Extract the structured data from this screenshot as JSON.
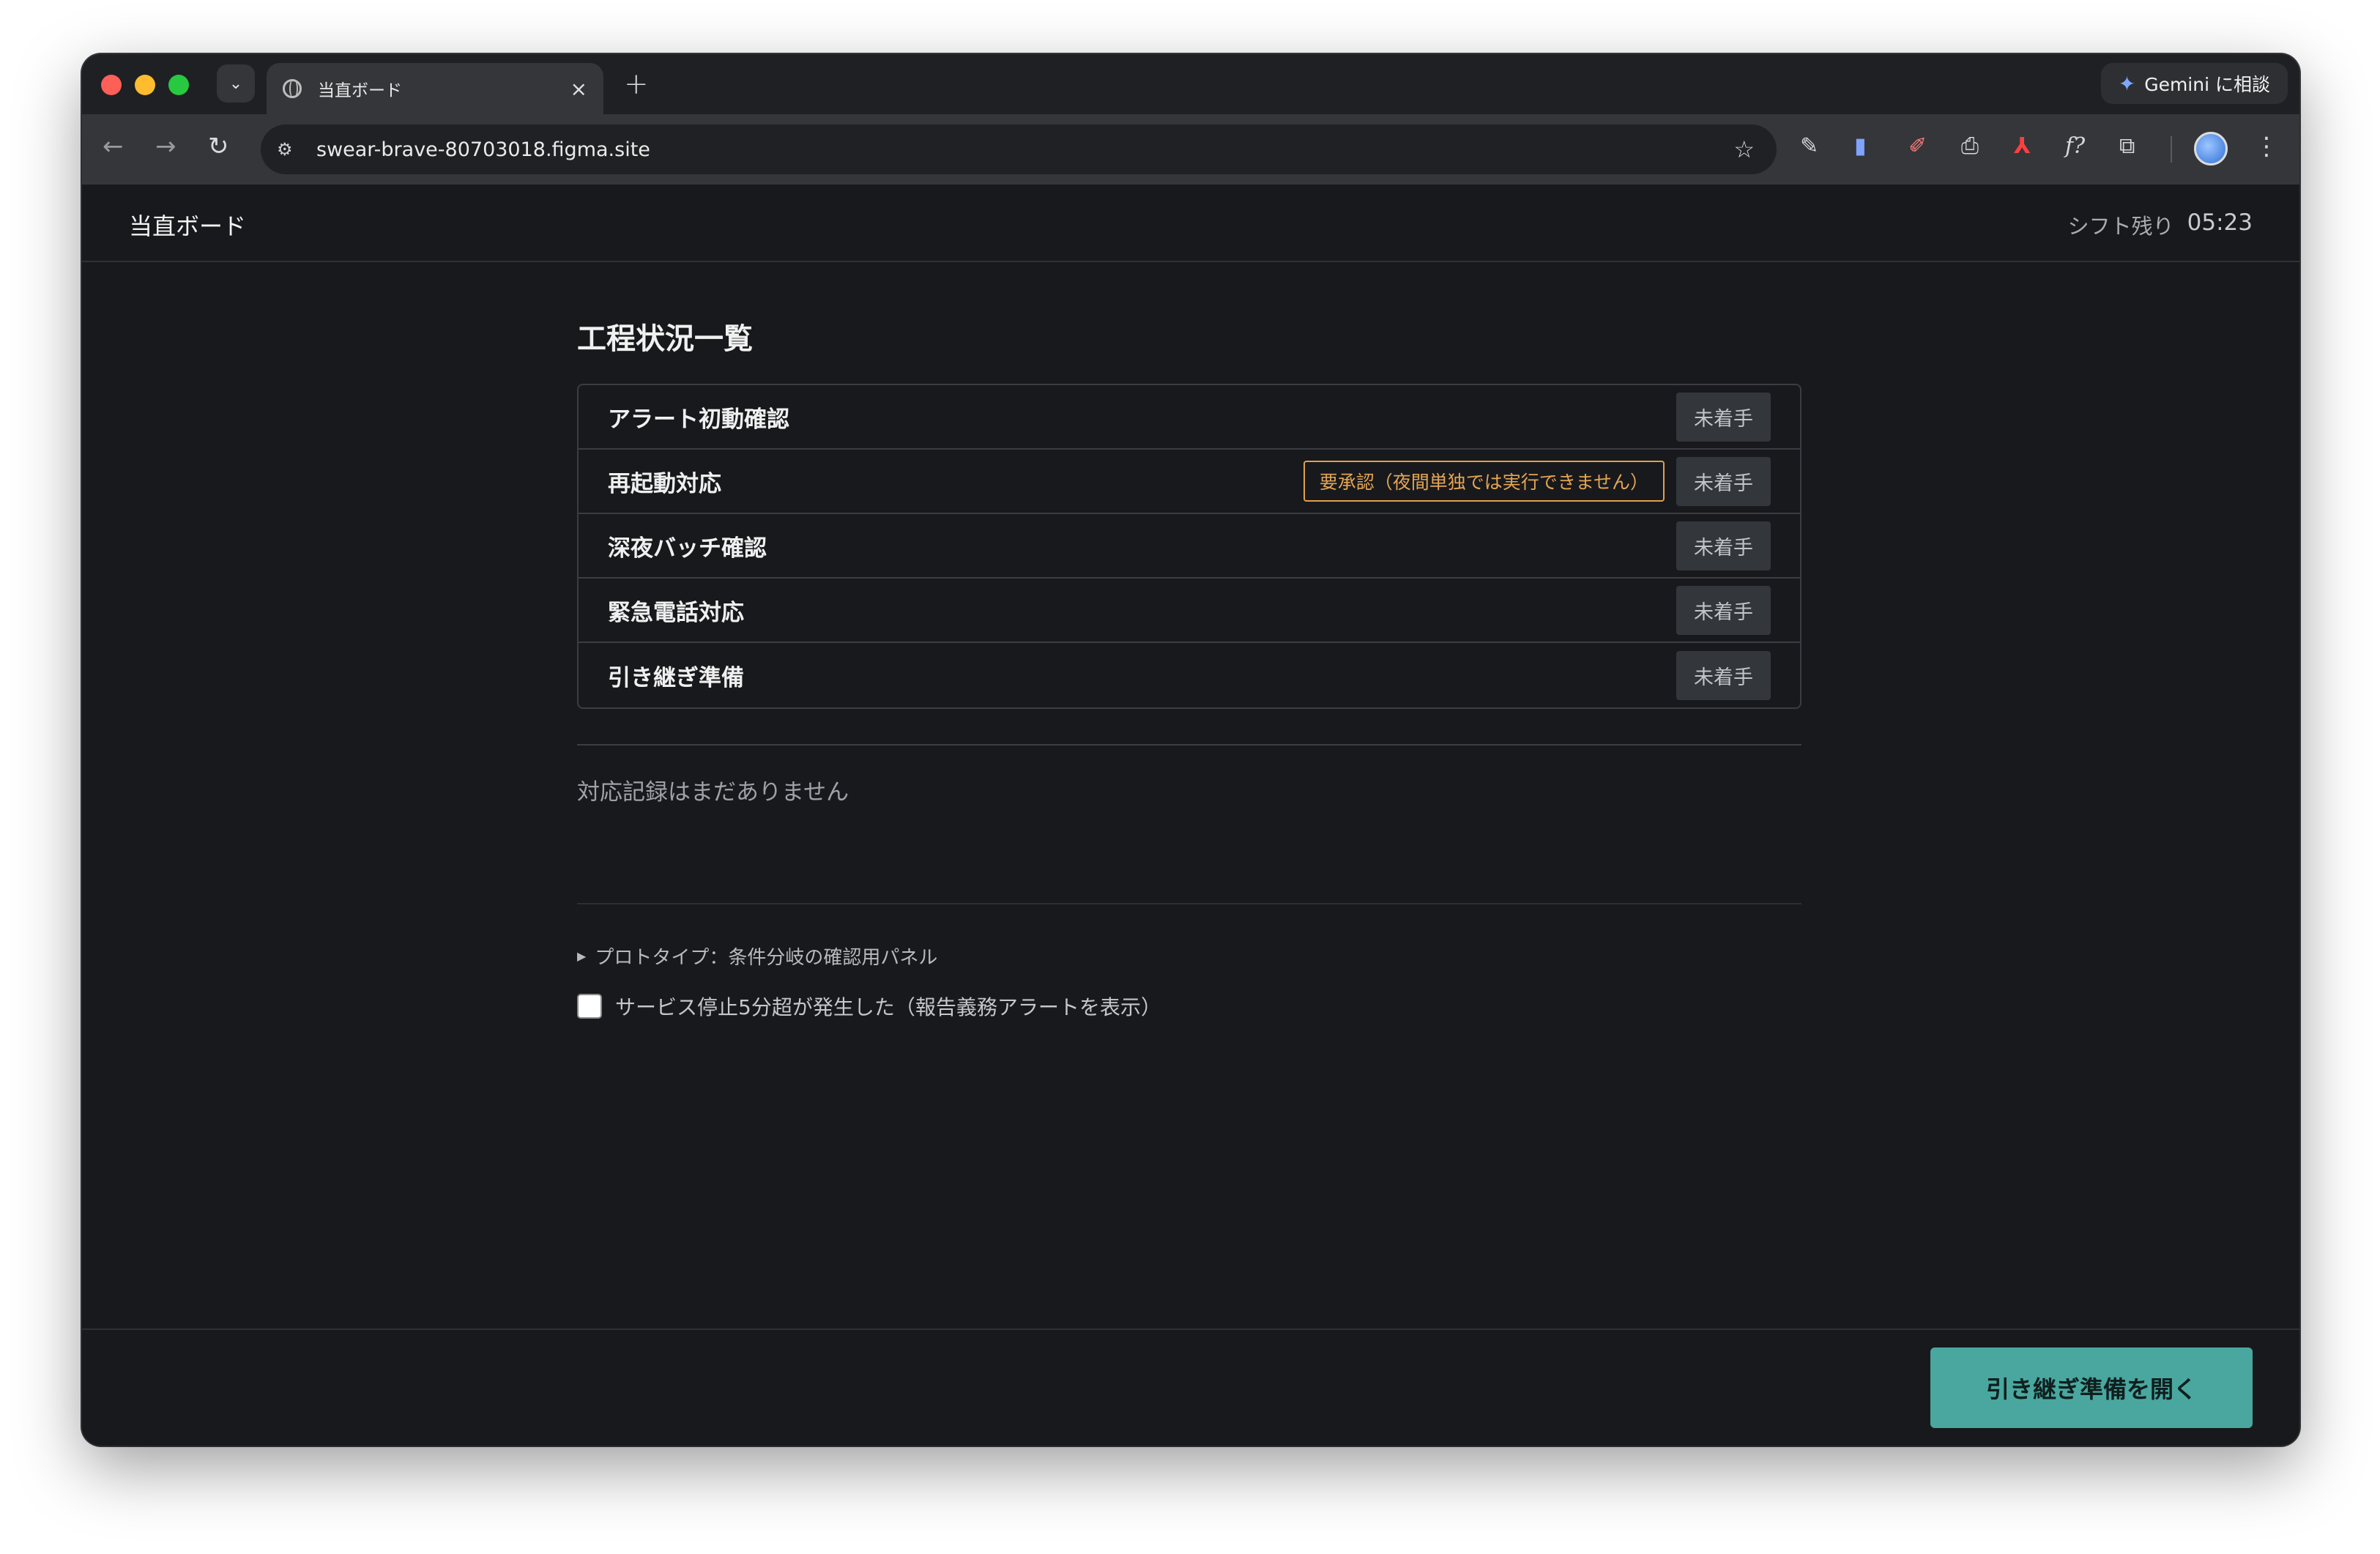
{
  "browser": {
    "tab_title": "当直ボード",
    "tab_close": "×",
    "new_tab": "+",
    "gemini_label": "Gemini に相談",
    "url": "swear-brave-80703018.figma.site"
  },
  "header": {
    "app_title": "当直ボード",
    "shift_label": "シフト残り",
    "shift_time": "05:23"
  },
  "main": {
    "section_title": "工程状況一覧",
    "tasks": [
      {
        "name": "アラート初動確認",
        "status": "未着手",
        "approval": ""
      },
      {
        "name": "再起動対応",
        "status": "未着手",
        "approval": "要承認（夜間単独では実行できません）"
      },
      {
        "name": "深夜バッチ確認",
        "status": "未着手",
        "approval": ""
      },
      {
        "name": "緊急電話対応",
        "status": "未着手",
        "approval": ""
      },
      {
        "name": "引き継ぎ準備",
        "status": "未着手",
        "approval": ""
      }
    ],
    "empty_log": "対応記録はまだありません",
    "prototype_summary": "プロトタイプ：条件分岐の確認用パネル",
    "checkbox_label": "サービス停止5分超が発生した（報告義務アラートを表示）"
  },
  "footer": {
    "handover_button": "引き継ぎ準備を開く"
  },
  "colors": {
    "page_bg": "#18191c",
    "accent": "#49a79f",
    "approval": "#e0a04b"
  }
}
